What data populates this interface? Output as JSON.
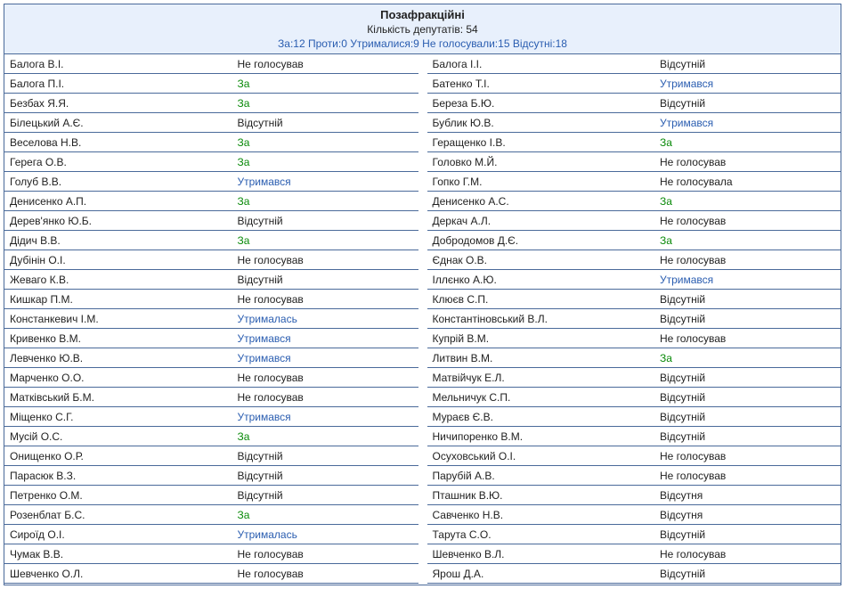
{
  "header": {
    "title": "Позафракційні",
    "count_label": "Кількість депутатів: 54",
    "summary": "За:12 Проти:0 Утрималися:9 Не голосували:15 Відсутні:18"
  },
  "left": [
    {
      "name": "Балога В.І.",
      "vote": "Не голосував",
      "cls": "vote-novote"
    },
    {
      "name": "Балога П.І.",
      "vote": "За",
      "cls": "vote-za"
    },
    {
      "name": "Безбах Я.Я.",
      "vote": "За",
      "cls": "vote-za"
    },
    {
      "name": "Білецький А.Є.",
      "vote": "Відсутній",
      "cls": "vote-absent"
    },
    {
      "name": "Веселова Н.В.",
      "vote": "За",
      "cls": "vote-za"
    },
    {
      "name": "Герега О.В.",
      "vote": "За",
      "cls": "vote-za"
    },
    {
      "name": "Голуб В.В.",
      "vote": "Утримався",
      "cls": "vote-abstain"
    },
    {
      "name": "Денисенко А.П.",
      "vote": "За",
      "cls": "vote-za"
    },
    {
      "name": "Дерев'янко Ю.Б.",
      "vote": "Відсутній",
      "cls": "vote-absent"
    },
    {
      "name": "Дідич В.В.",
      "vote": "За",
      "cls": "vote-za"
    },
    {
      "name": "Дубінін О.І.",
      "vote": "Не голосував",
      "cls": "vote-novote"
    },
    {
      "name": "Жеваго К.В.",
      "vote": "Відсутній",
      "cls": "vote-absent"
    },
    {
      "name": "Кишкар П.М.",
      "vote": "Не голосував",
      "cls": "vote-novote"
    },
    {
      "name": "Констанкевич І.М.",
      "vote": "Утрималась",
      "cls": "vote-abstain"
    },
    {
      "name": "Кривенко В.М.",
      "vote": "Утримався",
      "cls": "vote-abstain"
    },
    {
      "name": "Левченко Ю.В.",
      "vote": "Утримався",
      "cls": "vote-abstain"
    },
    {
      "name": "Марченко О.О.",
      "vote": "Не голосував",
      "cls": "vote-novote"
    },
    {
      "name": "Матківський Б.М.",
      "vote": "Не голосував",
      "cls": "vote-novote"
    },
    {
      "name": "Міщенко С.Г.",
      "vote": "Утримався",
      "cls": "vote-abstain"
    },
    {
      "name": "Мусій О.С.",
      "vote": "За",
      "cls": "vote-za"
    },
    {
      "name": "Онищенко О.Р.",
      "vote": "Відсутній",
      "cls": "vote-absent"
    },
    {
      "name": "Парасюк В.З.",
      "vote": "Відсутній",
      "cls": "vote-absent"
    },
    {
      "name": "Петренко О.М.",
      "vote": "Відсутній",
      "cls": "vote-absent"
    },
    {
      "name": "Розенблат Б.С.",
      "vote": "За",
      "cls": "vote-za"
    },
    {
      "name": "Сироїд О.І.",
      "vote": "Утрималась",
      "cls": "vote-abstain"
    },
    {
      "name": "Чумак В.В.",
      "vote": "Не голосував",
      "cls": "vote-novote"
    },
    {
      "name": "Шевченко О.Л.",
      "vote": "Не голосував",
      "cls": "vote-novote"
    }
  ],
  "right": [
    {
      "name": "Балога І.І.",
      "vote": "Відсутній",
      "cls": "vote-absent"
    },
    {
      "name": "Батенко Т.І.",
      "vote": "Утримався",
      "cls": "vote-abstain"
    },
    {
      "name": "Береза Б.Ю.",
      "vote": "Відсутній",
      "cls": "vote-absent"
    },
    {
      "name": "Бублик Ю.В.",
      "vote": "Утримався",
      "cls": "vote-abstain"
    },
    {
      "name": "Геращенко І.В.",
      "vote": "За",
      "cls": "vote-za"
    },
    {
      "name": "Головко М.Й.",
      "vote": "Не голосував",
      "cls": "vote-novote"
    },
    {
      "name": "Гопко Г.М.",
      "vote": "Не голосувала",
      "cls": "vote-novote"
    },
    {
      "name": "Денисенко А.С.",
      "vote": "За",
      "cls": "vote-za"
    },
    {
      "name": "Деркач А.Л.",
      "vote": "Не голосував",
      "cls": "vote-novote"
    },
    {
      "name": "Добродомов Д.Є.",
      "vote": "За",
      "cls": "vote-za"
    },
    {
      "name": "Єднак О.В.",
      "vote": "Не голосував",
      "cls": "vote-novote"
    },
    {
      "name": "Іллєнко А.Ю.",
      "vote": "Утримався",
      "cls": "vote-abstain"
    },
    {
      "name": "Клюєв С.П.",
      "vote": "Відсутній",
      "cls": "vote-absent"
    },
    {
      "name": "Константіновський В.Л.",
      "vote": "Відсутній",
      "cls": "vote-absent"
    },
    {
      "name": "Купрій В.М.",
      "vote": "Не голосував",
      "cls": "vote-novote"
    },
    {
      "name": "Литвин В.М.",
      "vote": "За",
      "cls": "vote-za"
    },
    {
      "name": "Матвійчук Е.Л.",
      "vote": "Відсутній",
      "cls": "vote-absent"
    },
    {
      "name": "Мельничук С.П.",
      "vote": "Відсутній",
      "cls": "vote-absent"
    },
    {
      "name": "Мураєв Є.В.",
      "vote": "Відсутній",
      "cls": "vote-absent"
    },
    {
      "name": "Ничипоренко В.М.",
      "vote": "Відсутній",
      "cls": "vote-absent"
    },
    {
      "name": "Осуховський О.І.",
      "vote": "Не голосував",
      "cls": "vote-novote"
    },
    {
      "name": "Парубій А.В.",
      "vote": "Не голосував",
      "cls": "vote-novote"
    },
    {
      "name": "Пташник В.Ю.",
      "vote": "Відсутня",
      "cls": "vote-absent"
    },
    {
      "name": "Савченко Н.В.",
      "vote": "Відсутня",
      "cls": "vote-absent"
    },
    {
      "name": "Тарута С.О.",
      "vote": "Відсутній",
      "cls": "vote-absent"
    },
    {
      "name": "Шевченко В.Л.",
      "vote": "Не голосував",
      "cls": "vote-novote"
    },
    {
      "name": "Ярош Д.А.",
      "vote": "Відсутній",
      "cls": "vote-absent"
    }
  ]
}
